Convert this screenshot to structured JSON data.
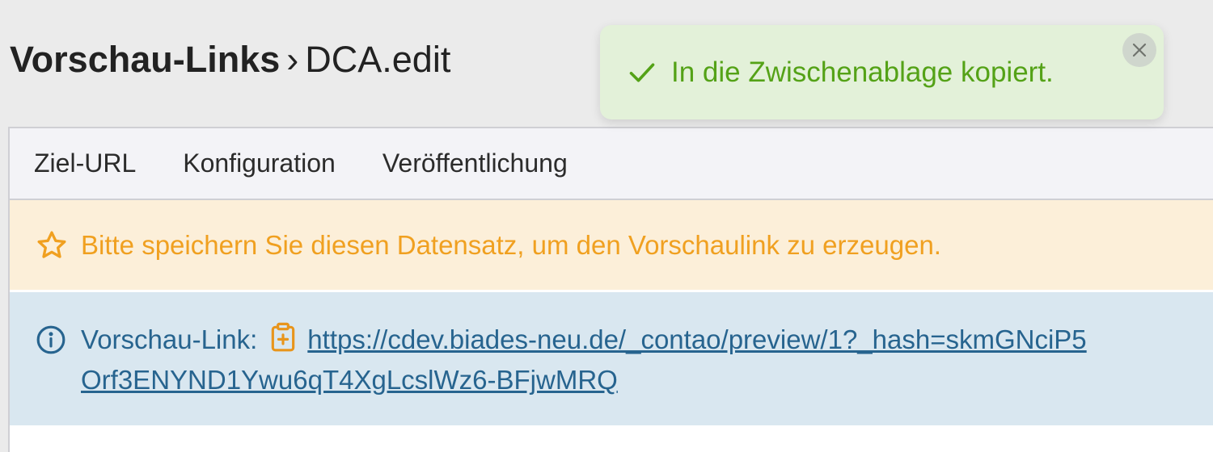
{
  "header": {
    "breadcrumb_main": "Vorschau-Links",
    "breadcrumb_separator": "›",
    "breadcrumb_sub": "DCA.edit"
  },
  "tabs": [
    {
      "label": "Ziel-URL"
    },
    {
      "label": "Konfiguration"
    },
    {
      "label": "Veröffentlichung"
    }
  ],
  "warning": {
    "icon": "star-icon",
    "text": "Bitte speichern Sie diesen Datensatz, um den Vorschaulink zu erzeugen.",
    "color": "#f0a020"
  },
  "info": {
    "icon": "info-icon",
    "label": "Vorschau-Link:",
    "copy_icon": "clipboard-icon",
    "link": "https://cdev.biades-neu.de/_contao/preview/1?_hash=skmGNciP5Orf3ENYND1Ywu6qT4XgLcslWz6-BFjwMRQ",
    "color": "#27648f"
  },
  "toast": {
    "icon": "check-icon",
    "message": "In die Zwischenablage kopiert.",
    "close_icon": "close-icon",
    "color": "#54a217"
  }
}
